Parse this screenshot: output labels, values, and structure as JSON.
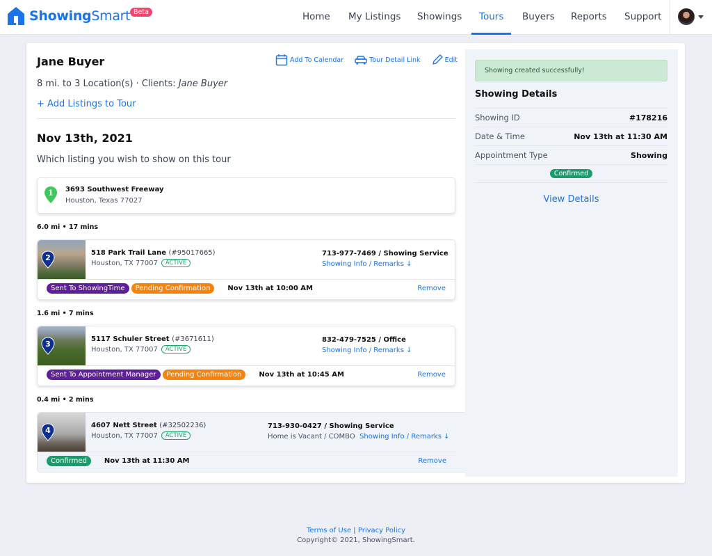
{
  "brand": {
    "name_bold": "Showing",
    "name_rest": "Smart",
    "badge": "Beta"
  },
  "nav": {
    "items": [
      {
        "label": "Home",
        "active": false
      },
      {
        "label": "My Listings",
        "active": false
      },
      {
        "label": "Showings",
        "active": false
      },
      {
        "label": "Tours",
        "active": true
      },
      {
        "label": "Buyers",
        "active": false
      },
      {
        "label": "Reports",
        "active": false
      },
      {
        "label": "Support",
        "active": false
      }
    ],
    "avatar_icon": "user-avatar"
  },
  "tour": {
    "title": "Jane Buyer",
    "actions": {
      "add_to_calendar": "Add To Calendar",
      "tour_detail_link": "Tour Detail Link",
      "edit": "Edit"
    },
    "summary_prefix": "8 mi. to 3 Location(s) · Clients: ",
    "summary_client": "Jane Buyer",
    "add_listings": "+ Add Listings to Tour",
    "date": "Nov 13th, 2021",
    "question": "Which listing you wish to show on this tour",
    "start": {
      "number": "1",
      "street": "3693 Southwest Freeway",
      "city": "Houston, Texas 77027"
    },
    "listings": [
      {
        "leg": "6.0 mi • 17 mins",
        "number": "2",
        "street": "518 Park Trail Lane",
        "mls": "(#95017665)",
        "city": "Houston, TX 77007",
        "status": "ACTIVE",
        "contact": "713-977-7469 / Showing Service",
        "note": "",
        "info_link": "Showing Info / Remarks ↓",
        "pills": [
          {
            "label": "Sent To ShowingTime",
            "color": "purple"
          },
          {
            "label": "Pending Confirmation",
            "color": "orange"
          }
        ],
        "time": "Nov 13th at 10:00 AM",
        "remove": "Remove"
      },
      {
        "leg": "1.6 mi • 7 mins",
        "number": "3",
        "street": "5117 Schuler Street",
        "mls": "(#3671611)",
        "city": "Houston, TX 77007",
        "status": "ACTIVE",
        "contact": "832-479-7525 / Office",
        "note": "",
        "info_link": "Showing Info / Remarks ↓",
        "pills": [
          {
            "label": "Sent To Appointment Manager",
            "color": "purple"
          },
          {
            "label": "Pending Confirmation",
            "color": "orange"
          }
        ],
        "time": "Nov 13th at 10:45 AM",
        "remove": "Remove"
      },
      {
        "leg": "0.4 mi • 2 mins",
        "number": "4",
        "street": "4607 Nett Street",
        "mls": "(#32502236)",
        "city": "Houston, TX 77007",
        "status": "ACTIVE",
        "contact": "713-930-0427 / Showing Service",
        "note": "Home is Vacant / COMBO",
        "info_link": "Showing Info / Remarks ↓",
        "pills": [
          {
            "label": "Confirmed",
            "color": "green"
          }
        ],
        "time": "Nov 13th at 11:30 AM",
        "remove": "Remove",
        "selected": true
      }
    ]
  },
  "details": {
    "alert": "Showing created successfully!",
    "title": "Showing Details",
    "rows": [
      {
        "label": "Showing ID",
        "value": "#178216"
      },
      {
        "label": "Date & Time",
        "value": "Nov 13th at 11:30 AM"
      },
      {
        "label": "Appointment Type",
        "value": "Showing"
      }
    ],
    "status": "Confirmed",
    "view_details": "View Details"
  },
  "footer": {
    "terms": "Terms of Use",
    "separator": " | ",
    "privacy": "Privacy Policy",
    "copyright": "Copyright© 2021, ShowingSmart."
  },
  "colors": {
    "accent": "#1a73e8",
    "purple": "#5f1e9b",
    "orange": "#f7830f",
    "green": "#1a9b6c",
    "beta": "#f2456b",
    "pin_blue": "#0d2f8f",
    "pin_green": "#3fc95a"
  }
}
